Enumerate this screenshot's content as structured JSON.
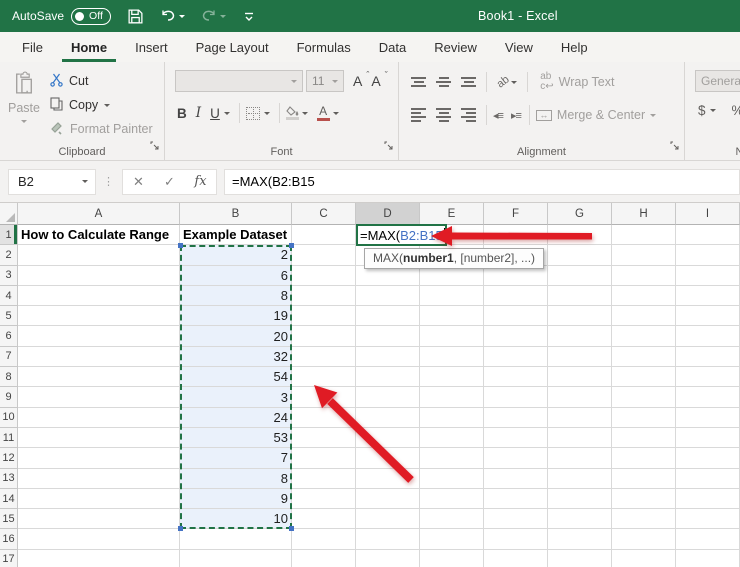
{
  "title_bar": {
    "autosave_label": "AutoSave",
    "autosave_state": "Off",
    "title": "Book1 - Excel"
  },
  "tabs": [
    {
      "label": "File",
      "active": false
    },
    {
      "label": "Home",
      "active": true
    },
    {
      "label": "Insert",
      "active": false
    },
    {
      "label": "Page Layout",
      "active": false
    },
    {
      "label": "Formulas",
      "active": false
    },
    {
      "label": "Data",
      "active": false
    },
    {
      "label": "Review",
      "active": false
    },
    {
      "label": "View",
      "active": false
    },
    {
      "label": "Help",
      "active": false
    }
  ],
  "ribbon": {
    "clipboard": {
      "group_label": "Clipboard",
      "paste_label": "Paste",
      "cut_label": "Cut",
      "copy_label": "Copy",
      "format_painter_label": "Format Painter"
    },
    "font": {
      "group_label": "Font",
      "font_size": "11"
    },
    "alignment": {
      "group_label": "Alignment",
      "wrap_text_label": "Wrap Text",
      "merge_center_label": "Merge & Center"
    },
    "number": {
      "group_label": "Number",
      "format_value": "General",
      "currency_label": "$",
      "percent_label": "%"
    }
  },
  "formula_bar": {
    "name_box_value": "B2",
    "formula_text": "=MAX(B2:B15"
  },
  "sheet": {
    "column_headers": [
      "A",
      "B",
      "C",
      "D",
      "E",
      "F",
      "G",
      "H",
      "I"
    ],
    "row_count": 17,
    "cells": {
      "A1": "How to Calculate Range",
      "B1": "Example Dataset"
    },
    "data_column": "B",
    "data_start_row": 2,
    "data_values": [
      2,
      6,
      8,
      19,
      20,
      32,
      54,
      3,
      24,
      53,
      7,
      8,
      9,
      10
    ],
    "active_cell": "D1",
    "edit": {
      "prefix": "=MAX(",
      "reference": "B2:B15"
    },
    "tooltip": {
      "before": "MAX(",
      "bold": "number1",
      "after": ", [number2], ...)"
    }
  },
  "colors": {
    "excel_green": "#217346",
    "reference_blue": "#4472c4",
    "range_fill": "#eaf1fb",
    "arrow_red": "#e01b24",
    "handle_blue": "#4472c4"
  }
}
